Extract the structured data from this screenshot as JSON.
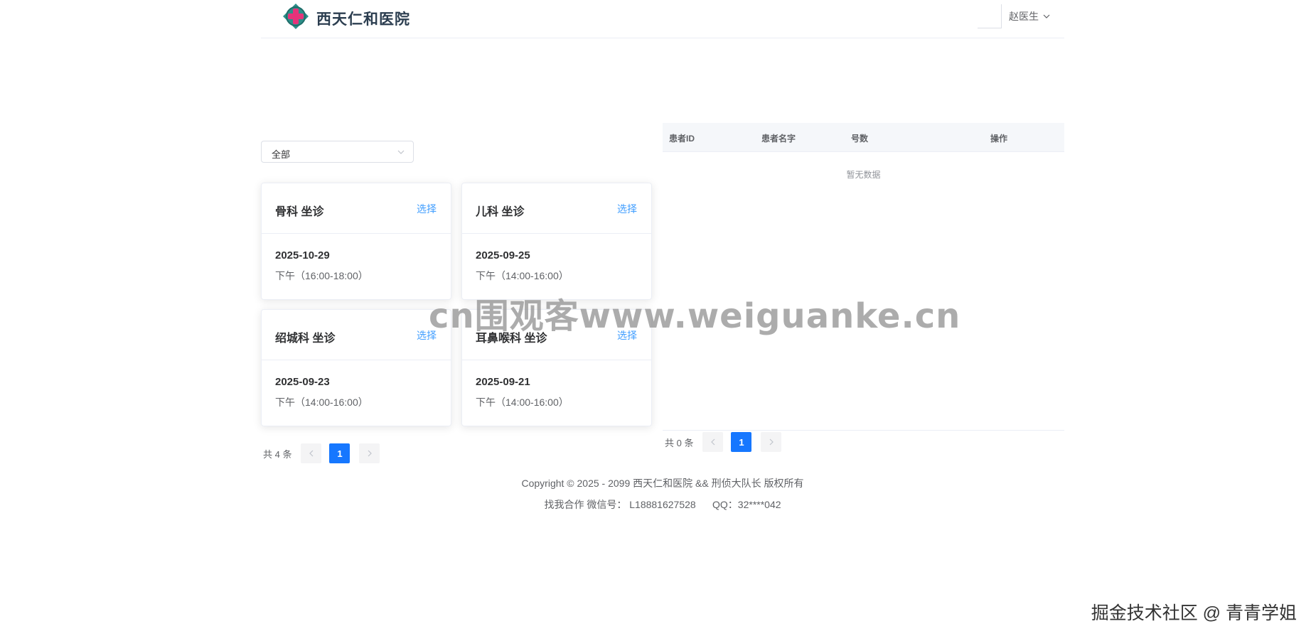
{
  "header": {
    "brand": "西天仁和医院",
    "user_name": "赵医生",
    "brand_colors": {
      "cross": "#e6337a",
      "ring": "#2e8f8a"
    }
  },
  "filter": {
    "selected": "全部"
  },
  "schedule_cards": [
    {
      "title": "骨科 坐诊",
      "action": "选择",
      "date": "2025-10-29",
      "time": "下午（16:00-18:00）"
    },
    {
      "title": "儿科 坐诊",
      "action": "选择",
      "date": "2025-09-25",
      "time": "下午（14:00-16:00）"
    },
    {
      "title": "绍城科 坐诊",
      "action": "选择",
      "date": "2025-09-23",
      "time": "下午（14:00-16:00）"
    },
    {
      "title": "耳鼻喉科 坐诊",
      "action": "选择",
      "date": "2025-09-21",
      "time": "下午（14:00-16:00）"
    }
  ],
  "left_pager": {
    "total": "共 4 条",
    "current": "1"
  },
  "patient_table": {
    "columns": [
      "患者ID",
      "患者名字",
      "号数",
      "操作"
    ],
    "empty_text": "暂无数据"
  },
  "right_pager": {
    "total": "共 0 条",
    "current": "1"
  },
  "footer": {
    "copyright": "Copyright © 2025 - 2099 西天仁和医院 && 刑侦大队长 版权所有",
    "contact": "找我合作 微信号： L18881627528      QQ：32****042"
  },
  "watermarks": {
    "center": "cn围观客www.weiguanke.cn",
    "corner": "掘金技术社区 @ 青青学姐"
  },
  "accent_color": "#1677ff",
  "link_color": "#409eff"
}
